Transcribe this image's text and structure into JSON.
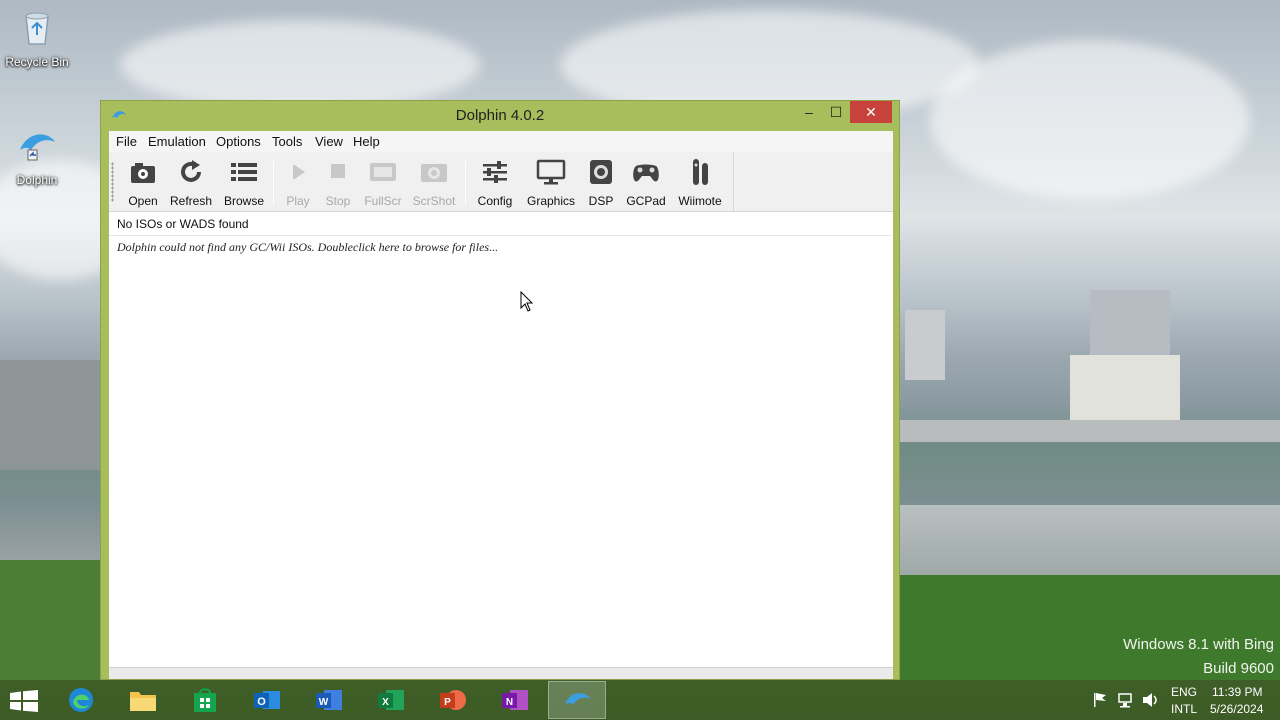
{
  "desktop": {
    "icons": [
      {
        "label": "Recycle Bin"
      },
      {
        "label": "Dolphin"
      }
    ],
    "watermark": {
      "line1": "Windows 8.1 with Bing",
      "line2": "Build 9600"
    }
  },
  "window": {
    "title": "Dolphin 4.0.2",
    "controls": {
      "minimize": "–",
      "maximize": "☐",
      "close": "✕"
    },
    "menu": [
      "File",
      "Emulation",
      "Options",
      "Tools",
      "View",
      "Help"
    ],
    "toolbar": [
      {
        "label": "Open",
        "enabled": true
      },
      {
        "label": "Refresh",
        "enabled": true
      },
      {
        "label": "Browse",
        "enabled": true
      },
      {
        "label": "Play",
        "enabled": false
      },
      {
        "label": "Stop",
        "enabled": false
      },
      {
        "label": "FullScr",
        "enabled": false
      },
      {
        "label": "ScrShot",
        "enabled": false
      },
      {
        "label": "Config",
        "enabled": true
      },
      {
        "label": "Graphics",
        "enabled": true
      },
      {
        "label": "DSP",
        "enabled": true
      },
      {
        "label": "GCPad",
        "enabled": true
      },
      {
        "label": "Wiimote",
        "enabled": true
      }
    ],
    "list": {
      "header": "No ISOs or WADS found",
      "message": "Dolphin could not find any GC/Wii ISOs.  Doubleclick here to browse for files..."
    }
  },
  "taskbar": {
    "apps": [
      "Edge",
      "File Explorer",
      "Store",
      "Outlook",
      "Word",
      "Excel",
      "PowerPoint",
      "OneNote",
      "Dolphin"
    ],
    "active_app": "Dolphin",
    "language": {
      "line1": "ENG",
      "line2": "INTL"
    },
    "clock": {
      "time": "11:39 PM",
      "date": "5/26/2024"
    }
  },
  "colors": {
    "window_frame": "#a8bd5c",
    "close_button": "#c7423a",
    "taskbar": "#3c5523"
  }
}
